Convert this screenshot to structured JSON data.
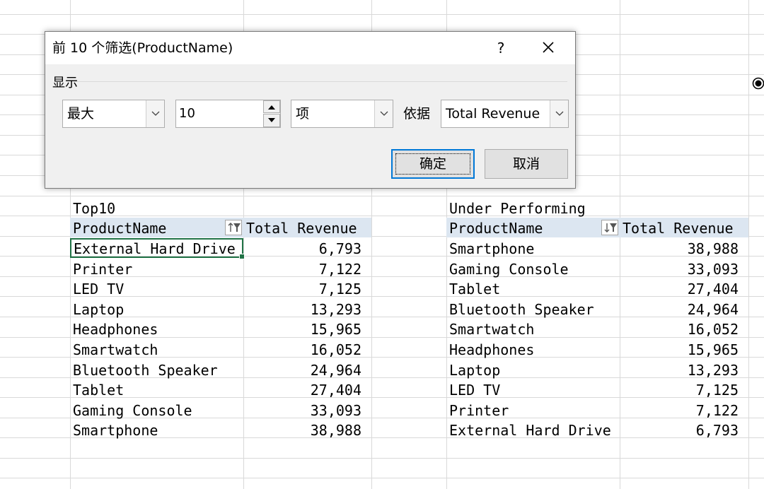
{
  "dialog": {
    "title": "前 10 个筛选(ProductName)",
    "help_label": "?",
    "group_label": "显示",
    "direction_value": "最大",
    "count_value": "10",
    "unit_value": "项",
    "basis_label": "依据",
    "basis_value": "Total Revenue",
    "ok_label": "确定",
    "cancel_label": "取消"
  },
  "top10": {
    "caption": "Top10",
    "col1_header": "ProductName",
    "col2_header": "Total Revenue",
    "rows": [
      {
        "name": "External Hard Drive",
        "value": "6,793"
      },
      {
        "name": "Printer",
        "value": "7,122"
      },
      {
        "name": "LED TV",
        "value": "7,125"
      },
      {
        "name": "Laptop",
        "value": "13,293"
      },
      {
        "name": "Headphones",
        "value": "15,965"
      },
      {
        "name": "Smartwatch",
        "value": "16,052"
      },
      {
        "name": "Bluetooth Speaker",
        "value": "24,964"
      },
      {
        "name": "Tablet",
        "value": "27,404"
      },
      {
        "name": "Gaming Console",
        "value": "33,093"
      },
      {
        "name": "Smartphone",
        "value": "38,988"
      }
    ]
  },
  "under": {
    "caption": "Under Performing",
    "col1_header": "ProductName",
    "col2_header": "Total Revenue",
    "rows": [
      {
        "name": "Smartphone",
        "value": "38,988"
      },
      {
        "name": "Gaming Console",
        "value": "33,093"
      },
      {
        "name": "Tablet",
        "value": "27,404"
      },
      {
        "name": "Bluetooth Speaker",
        "value": "24,964"
      },
      {
        "name": "Smartwatch",
        "value": "16,052"
      },
      {
        "name": "Headphones",
        "value": "15,965"
      },
      {
        "name": "Laptop",
        "value": "13,293"
      },
      {
        "name": "LED TV",
        "value": "7,125"
      },
      {
        "name": "Printer",
        "value": "7,122"
      },
      {
        "name": "External Hard Drive",
        "value": "6,793"
      }
    ]
  },
  "colors": {
    "header_fill": "#dce6f1",
    "selection": "#217346",
    "dialog_focus": "#0078d7"
  },
  "icons": [
    "filter-sort-ascending-icon",
    "filter-sort-descending-icon",
    "close-icon",
    "chevron-down-icon",
    "spin-up-icon",
    "spin-down-icon",
    "radio-icon"
  ]
}
